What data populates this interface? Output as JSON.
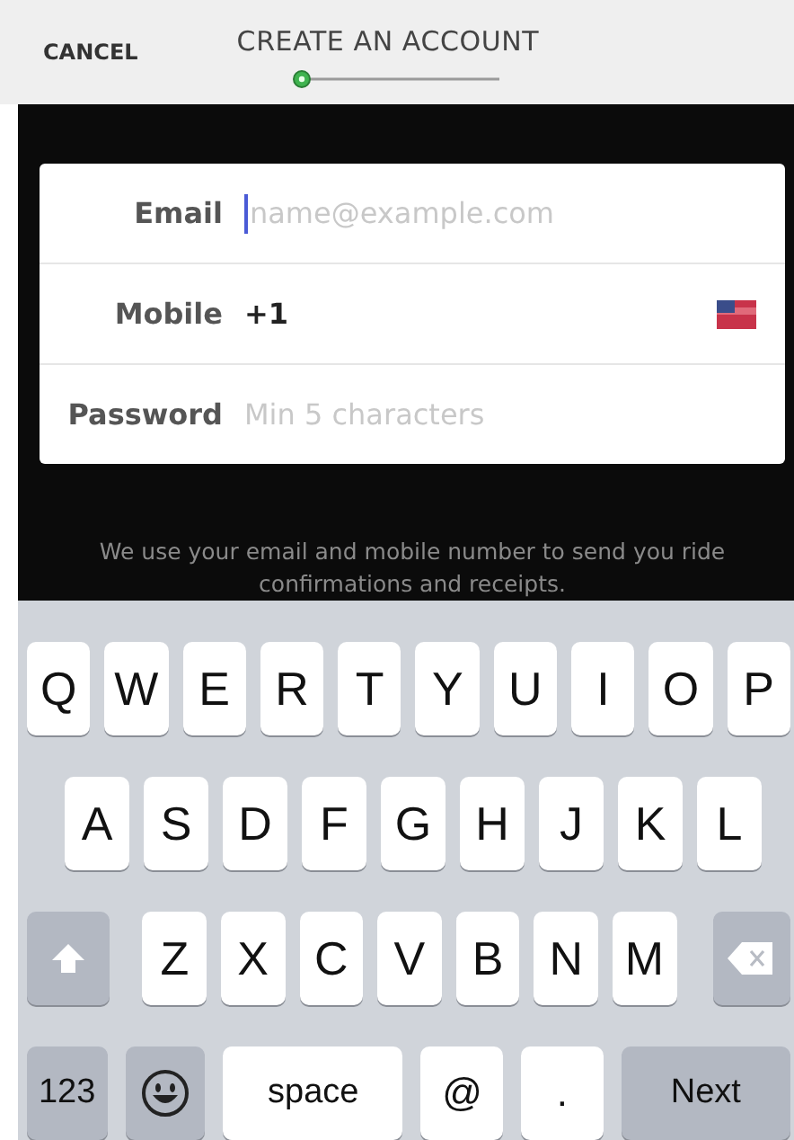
{
  "header": {
    "cancel": "CANCEL",
    "title": "CREATE AN ACCOUNT"
  },
  "fields": [
    {
      "label": "Email",
      "placeholder": "name@example.com",
      "focused": true,
      "kind": "email"
    },
    {
      "label": "Mobile",
      "value": "+1",
      "focused": false,
      "kind": "phone"
    },
    {
      "label": "Password",
      "placeholder": "Min 5 characters",
      "focused": false,
      "kind": "password"
    }
  ],
  "note": "We use your email and mobile number to send you ride confirmations and receipts.",
  "keyboard": [
    [
      {
        "kind": "letter",
        "label": "Q"
      },
      {
        "kind": "letter",
        "label": "W"
      },
      {
        "kind": "letter",
        "label": "E"
      },
      {
        "kind": "letter",
        "label": "R"
      },
      {
        "kind": "letter",
        "label": "T"
      },
      {
        "kind": "letter",
        "label": "Y"
      },
      {
        "kind": "letter",
        "label": "U"
      },
      {
        "kind": "letter",
        "label": "I"
      },
      {
        "kind": "letter",
        "label": "O"
      },
      {
        "kind": "letter",
        "label": "P"
      }
    ],
    [
      {
        "kind": "letter",
        "label": "A"
      },
      {
        "kind": "letter",
        "label": "S"
      },
      {
        "kind": "letter",
        "label": "D"
      },
      {
        "kind": "letter",
        "label": "F"
      },
      {
        "kind": "letter",
        "label": "G"
      },
      {
        "kind": "letter",
        "label": "H"
      },
      {
        "kind": "letter",
        "label": "J"
      },
      {
        "kind": "letter",
        "label": "K"
      },
      {
        "kind": "letter",
        "label": "L"
      }
    ],
    [
      {
        "kind": "shift"
      },
      {
        "kind": "letter",
        "label": "Z"
      },
      {
        "kind": "letter",
        "label": "X"
      },
      {
        "kind": "letter",
        "label": "C"
      },
      {
        "kind": "letter",
        "label": "V"
      },
      {
        "kind": "letter",
        "label": "B"
      },
      {
        "kind": "letter",
        "label": "N"
      },
      {
        "kind": "letter",
        "label": "M"
      },
      {
        "kind": "delete"
      }
    ],
    [
      {
        "kind": "mode",
        "label": "123"
      },
      {
        "kind": "emoji"
      },
      {
        "kind": "space",
        "label": "space"
      },
      {
        "kind": "symbol",
        "label": "@"
      },
      {
        "kind": "symbol",
        "label": "."
      },
      {
        "kind": "action",
        "label": "Next"
      }
    ]
  ]
}
